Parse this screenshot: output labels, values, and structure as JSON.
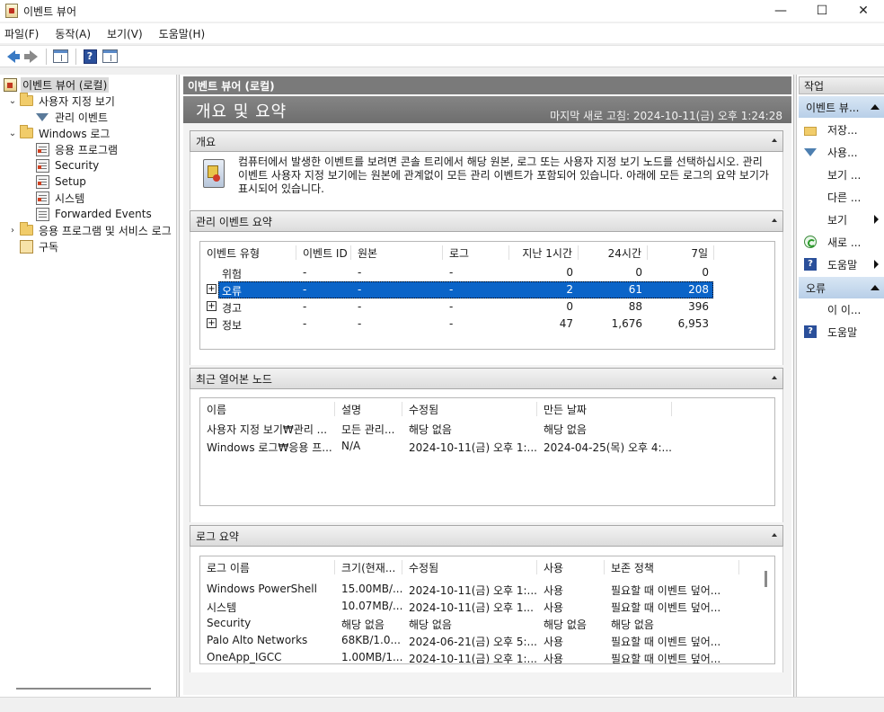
{
  "window": {
    "title": "이벤트 뷰어",
    "minimize": "—",
    "maximize": "☐",
    "close": "✕"
  },
  "menu": [
    "파일(F)",
    "동작(A)",
    "보기(V)",
    "도움말(H)"
  ],
  "toolbar": {
    "help_glyph": "?"
  },
  "tree": [
    {
      "label": "이벤트 뷰어 (로컬)",
      "icon": "viewer",
      "expander": "",
      "indent": 0,
      "selected": true
    },
    {
      "label": "사용자 지정 보기",
      "icon": "folder",
      "expander": "⌄",
      "indent": 1
    },
    {
      "label": "관리 이벤트",
      "icon": "filter",
      "expander": "",
      "indent": 2
    },
    {
      "label": "Windows 로그",
      "icon": "folder",
      "expander": "⌄",
      "indent": 1
    },
    {
      "label": "응용 프로그램",
      "icon": "log-red",
      "expander": "",
      "indent": 2
    },
    {
      "label": "Security",
      "icon": "log-red",
      "expander": "",
      "indent": 2
    },
    {
      "label": "Setup",
      "icon": "log-red",
      "expander": "",
      "indent": 2
    },
    {
      "label": "시스템",
      "icon": "log-red",
      "expander": "",
      "indent": 2
    },
    {
      "label": "Forwarded Events",
      "icon": "log",
      "expander": "",
      "indent": 2
    },
    {
      "label": "응용 프로그램 및 서비스 로그",
      "icon": "folder",
      "expander": "›",
      "indent": 1
    },
    {
      "label": "구독",
      "icon": "subscription",
      "expander": "",
      "indent": 1
    }
  ],
  "center": {
    "header": "이벤트 뷰어 (로컬)",
    "summary_title": "개요 및 요약",
    "last_refresh": "마지막 새로 고침: 2024-10-11(금) 오후 1:24:28"
  },
  "overview": {
    "title": "개요",
    "text": "컴퓨터에서 발생한 이벤트를 보려면 콘솔 트리에서 해당 원본, 로그 또는 사용자 지정 보기 노드를 선택하십시오. 관리 이벤트 사용자 지정 보기에는 원본에 관계없이 모든 관리 이벤트가 포함되어 있습니다. 아래에 모든 로그의 요약 보기가 표시되어 있습니다."
  },
  "admin_summary": {
    "title": "관리 이벤트 요약",
    "columns": [
      "이벤트 유형",
      "이벤트 ID",
      "원본",
      "로그",
      "지난 1시간",
      "24시간",
      "7일"
    ],
    "rows": [
      {
        "type": "위험",
        "id": "-",
        "source": "-",
        "log": "-",
        "h1": "0",
        "h24": "0",
        "d7": "0",
        "expand": "",
        "selected": false
      },
      {
        "type": "오류",
        "id": "-",
        "source": "-",
        "log": "-",
        "h1": "2",
        "h24": "61",
        "d7": "208",
        "expand": "+",
        "selected": true
      },
      {
        "type": "경고",
        "id": "-",
        "source": "-",
        "log": "-",
        "h1": "0",
        "h24": "88",
        "d7": "396",
        "expand": "+",
        "selected": false
      },
      {
        "type": "정보",
        "id": "-",
        "source": "-",
        "log": "-",
        "h1": "47",
        "h24": "1,676",
        "d7": "6,953",
        "expand": "+",
        "selected": false
      }
    ]
  },
  "recent_nodes": {
    "title": "최근 열어본 노드",
    "columns": [
      "이름",
      "설명",
      "수정됨",
      "만든 날짜"
    ],
    "rows": [
      [
        "사용자 지정 보기₩관리 ...",
        "모든 관리...",
        "해당 없음",
        "해당 없음"
      ],
      [
        "Windows 로그₩응용 프...",
        "N/A",
        "2024-10-11(금) 오후 1:...",
        "2024-04-25(목) 오후 4:..."
      ]
    ]
  },
  "log_summary": {
    "title": "로그 요약",
    "columns": [
      "로그 이름",
      "크기(현재...",
      "수정됨",
      "사용",
      "보존 정책"
    ],
    "rows": [
      [
        "Windows PowerShell",
        "15.00MB/...",
        "2024-10-11(금) 오후 1:...",
        "사용",
        "필요할 때 이벤트 덮어..."
      ],
      [
        "시스템",
        "10.07MB/...",
        "2024-10-11(금) 오후 1...",
        "사용",
        "필요할 때 이벤트 덮어..."
      ],
      [
        "Security",
        "해당 없음",
        "해당 없음",
        "해당 없음",
        "해당 없음"
      ],
      [
        "Palo Alto Networks",
        "68KB/1.0...",
        "2024-06-21(금) 오후 5:...",
        "사용",
        "필요할 때 이벤트 덮어..."
      ],
      [
        "OneApp_IGCC",
        "1.00MB/1...",
        "2024-10-11(금) 오후 1:...",
        "사용",
        "필요할 때 이벤트 덮어..."
      ]
    ]
  },
  "actions": {
    "header": "작업",
    "group1": "이벤트 뷰...",
    "items1": [
      {
        "label": "저장...",
        "icon": "folder"
      },
      {
        "label": "사용...",
        "icon": "filter"
      },
      {
        "label": "보기 ...",
        "icon": "blank"
      },
      {
        "label": "다른 ...",
        "icon": "blank"
      },
      {
        "label": "보기",
        "icon": "blank",
        "submenu": true
      },
      {
        "label": "새로 ...",
        "icon": "refresh"
      },
      {
        "label": "도움말",
        "icon": "help",
        "submenu": true
      }
    ],
    "group2": "오류",
    "items2": [
      {
        "label": "이 이...",
        "icon": "blank"
      },
      {
        "label": "도움말",
        "icon": "help"
      }
    ]
  }
}
